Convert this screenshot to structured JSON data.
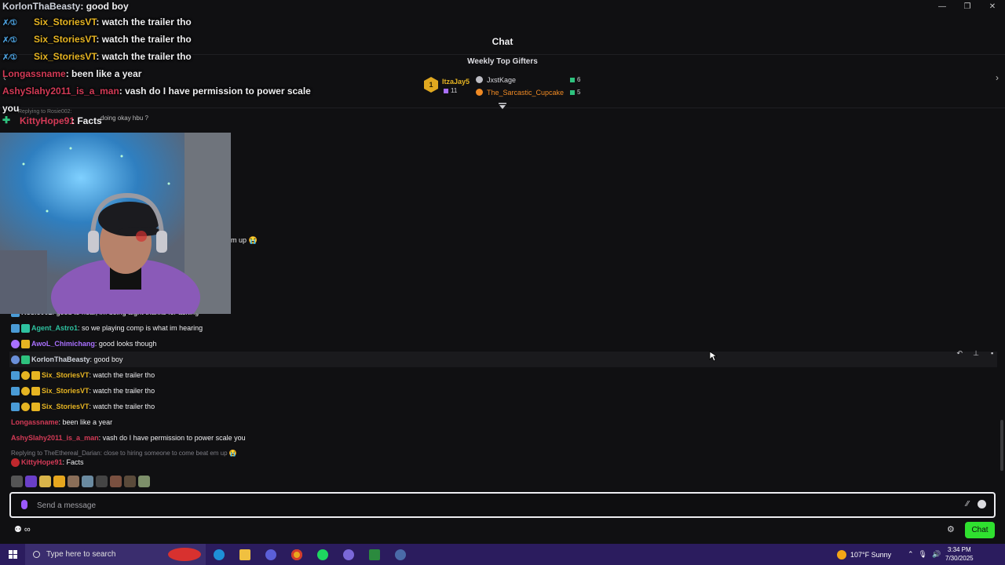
{
  "window": {
    "minimize": "—",
    "restore": "❐",
    "close": "✕"
  },
  "overlay": {
    "top_line": {
      "name": "KorlonThaBeasty",
      "text": ": good boy",
      "name_color": "#cfd3dc"
    },
    "lines": [
      {
        "name": "Six_StoriesVT",
        "text": ": watch the trailer tho",
        "name_color": "#e6b422"
      },
      {
        "name": "Six_StoriesVT",
        "text": ": watch the trailer tho",
        "name_color": "#e6b422"
      },
      {
        "name": "Six_StoriesVT",
        "text": ": watch the trailer tho",
        "name_color": "#e6b422"
      },
      {
        "name": "Longassname",
        "text": ": been like a year",
        "name_color": "#d33a56"
      },
      {
        "name": "AshySlahy2011_is_a_man",
        "text": ": vash do I have permission to power scale",
        "name_color": "#d33a56"
      }
    ],
    "wrap": "you",
    "last_name": "KittyHope91",
    "last_text": ": Facts",
    "reply_ghost": "Replying to Rosie002:",
    "reply_ghost_text": "doing okay hbu ?"
  },
  "header": {
    "title": "Chat"
  },
  "gifters": {
    "title": "Weekly Top Gifters",
    "first": {
      "rank": "1",
      "name": "ItzaJay5",
      "count": "11"
    },
    "others": [
      {
        "name": "JxstKage",
        "count": "6",
        "color": "#d9d9de"
      },
      {
        "name": "The_Sarcastic_Cupcake",
        "count": "5",
        "color": "#f08a24"
      }
    ]
  },
  "cut_text": "m up 😭",
  "messages": [
    {
      "name": "Rosie002",
      "text": ": good to hear, im doing aight thanks for asking",
      "color": "#cfd3dc",
      "partial": true
    },
    {
      "name": "Agent_Astro1",
      "text": ": so we playing comp is what im hearing",
      "color": "#2ec2a0"
    },
    {
      "name": "AwoL_Chimichang",
      "text": ": good looks though",
      "color": "#a970ff"
    },
    {
      "name": "KorlonThaBeasty",
      "text": ": good boy",
      "color": "#cfd3dc",
      "highlight": true
    },
    {
      "name": "Six_StoriesVT",
      "text": ": watch the trailer tho",
      "color": "#e6b422"
    },
    {
      "name": "Six_StoriesVT",
      "text": ": watch the trailer tho",
      "color": "#e6b422"
    },
    {
      "name": "Six_StoriesVT",
      "text": ": watch the trailer tho",
      "color": "#e6b422"
    },
    {
      "name": "Longassname",
      "text": ": been like a year",
      "color": "#d33a56"
    },
    {
      "name": "AshySlahy2011_is_a_man",
      "text": ": vash do I have permission to power scale you",
      "color": "#d33a56"
    },
    {
      "name": "KittyHope91",
      "text": ": Facts",
      "color": "#d33a56"
    }
  ],
  "reply_context": "Replying to TheEthereal_Darian: close to hiring someone to come beat em up 😭",
  "input": {
    "placeholder": "Send a message"
  },
  "bottom": {
    "points": "∞",
    "chat_button": "Chat"
  },
  "taskbar": {
    "search_placeholder": "Type here to search",
    "weather": "107°F  Sunny",
    "time": "3:34 PM",
    "date": "7/30/2025"
  }
}
